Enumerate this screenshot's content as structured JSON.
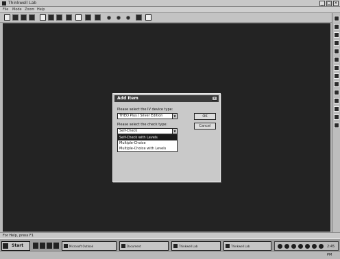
{
  "window": {
    "title": "Thinkwell Lab",
    "min_glyph": "_",
    "max_glyph": "□",
    "close_glyph": "×"
  },
  "menu": [
    "File",
    "Mode",
    "Zoom",
    "Help"
  ],
  "toolbar": {
    "icons": [
      "new-icon",
      "open-icon",
      "save-icon",
      "print-icon",
      "cut-icon",
      "copy-icon",
      "paste-icon",
      "image-icon",
      "chart-icon",
      "list-icon",
      "dot-icon",
      "dot-icon",
      "dot-icon",
      "audio-icon",
      "help-icon"
    ]
  },
  "dialog": {
    "title": "Add Item",
    "close_glyph": "×",
    "label_format": "Please select the IV device type:",
    "select_format_value": "THEO Plus / Silver Edition",
    "label_check": "Please select the check type:",
    "select_check_value": "Self-Check",
    "dropdown_options": [
      "Self-Check with Levels",
      "Multiple-Choice",
      "Multiple-Choice with Levels"
    ],
    "ok_label": "OK",
    "cancel_label": "Cancel",
    "arrow_glyph": "▼"
  },
  "status": {
    "text": "For Help, press F1"
  },
  "taskbar": {
    "start_label": "Start",
    "tasks": [
      "Microsoft Outlook",
      "Document",
      "Thinkwell Lab",
      "Thinkwell Lab"
    ],
    "clock": "2:45 PM"
  },
  "colors": {
    "workspace": "#232323",
    "dialog_title": "#3a3a3a",
    "highlight": "#1a1a1a"
  }
}
